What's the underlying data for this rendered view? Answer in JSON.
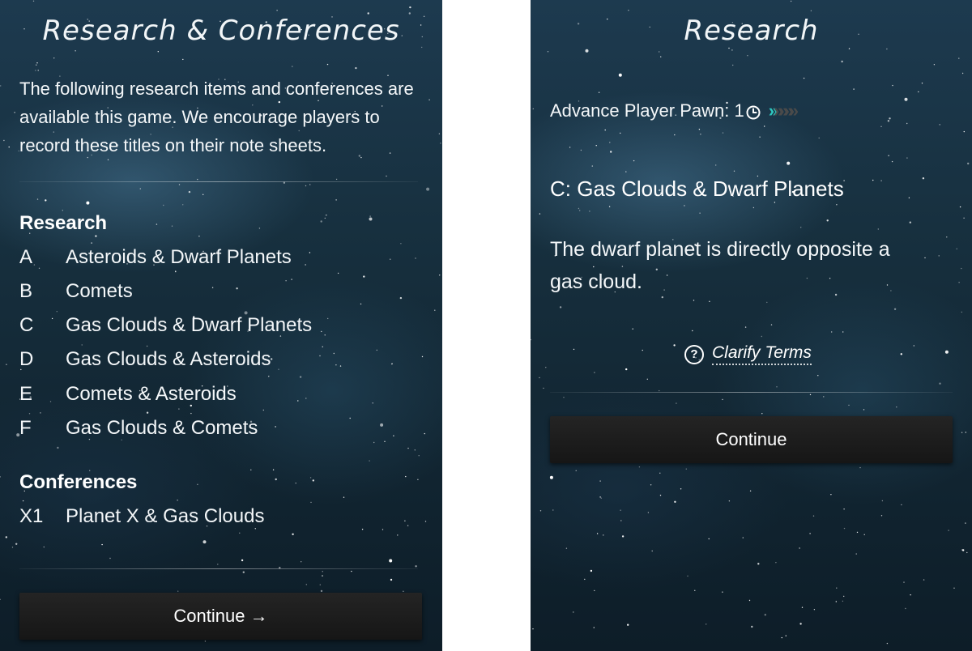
{
  "left": {
    "title": "Research & Conferences",
    "intro": "The following research items and conferences are available this game. We encourage players to record these titles on their note sheets.",
    "research_heading": "Research",
    "research_items": [
      {
        "code": "A",
        "label": "Asteroids & Dwarf Planets"
      },
      {
        "code": "B",
        "label": "Comets"
      },
      {
        "code": "C",
        "label": "Gas Clouds & Dwarf Planets"
      },
      {
        "code": "D",
        "label": "Gas Clouds & Asteroids"
      },
      {
        "code": "E",
        "label": "Comets & Asteroids"
      },
      {
        "code": "F",
        "label": "Gas Clouds & Comets"
      }
    ],
    "conferences_heading": "Conferences",
    "conference_items": [
      {
        "code": "X1",
        "label": "Planet X & Gas Clouds"
      }
    ],
    "continue_label": "Continue →"
  },
  "right": {
    "title": "Research",
    "advance_label": "Advance Player Pawn: 1",
    "clock_icon": "clock-icon",
    "progress": {
      "active": 1,
      "total": 5,
      "active_color": "#2ec9c0",
      "inactive_color": "#4a4a4a"
    },
    "item_title": "C: Gas Clouds & Dwarf Planets",
    "item_description": "The dwarf planet is directly opposite a gas cloud.",
    "clarify_icon": "question-circle-icon",
    "clarify_label": "Clarify Terms",
    "continue_label": "Continue"
  }
}
